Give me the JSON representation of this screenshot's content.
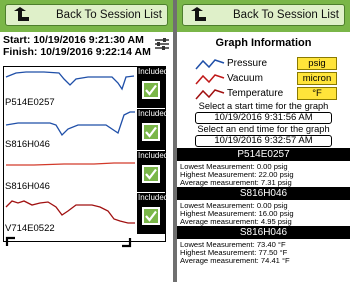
{
  "colors": {
    "accent_green": "#7ab648",
    "pressure_blue": "#1f4fa8",
    "vacuum_red": "#c01818",
    "unit_yellow": "#ffe43a"
  },
  "left": {
    "back_label": "Back To Session List",
    "start": "Start: 10/19/2016 9:21:30 AM",
    "finish": "Finish: 10/19/2016 9:22:14 AM",
    "rows": [
      {
        "serial": "P514E0257",
        "included_label": "Included",
        "checked": true,
        "color": "#1f4fa8"
      },
      {
        "serial": "S816H046",
        "included_label": "Included",
        "checked": true,
        "color": "#1f4fa8"
      },
      {
        "serial": "S816H046",
        "included_label": "Included",
        "checked": true,
        "color": "#c01818"
      },
      {
        "serial": "V714E0522",
        "included_label": "Included",
        "checked": true,
        "color": "#a01010"
      }
    ]
  },
  "right": {
    "back_label": "Back To Session List",
    "title": "Graph Information",
    "legend": [
      {
        "label": "Pressure",
        "unit": "psig",
        "icon": "pressure-line-icon"
      },
      {
        "label": "Vacuum",
        "unit": "micron",
        "icon": "vacuum-line-icon"
      },
      {
        "label": "Temperature",
        "unit": "°F",
        "icon": "temperature-line-icon"
      }
    ],
    "start_prompt": "Select a start time for the graph",
    "start_value": "10/19/2016 9:31:56 AM",
    "end_prompt": "Select an end time for the graph",
    "end_value": "10/19/2016 9:32:57 AM",
    "sensors": [
      {
        "name": "P514E0257",
        "lowest": "Lowest Measurement: 0.00 psig",
        "highest": "Highest Measurement: 22.00 psig",
        "average": "Average measurement: 7.31 psig"
      },
      {
        "name": "S816H046",
        "lowest": "Lowest Measurement: 0.00 psig",
        "highest": "Highest Measurement: 16.00 psig",
        "average": "Average measurement: 4.95 psig"
      },
      {
        "name": "S816H046",
        "lowest": "Lowest Measurement: 73.40 °F",
        "highest": "Highest Measurement: 77.50 °F",
        "average": "Average measurement: 74.41 °F"
      }
    ]
  }
}
